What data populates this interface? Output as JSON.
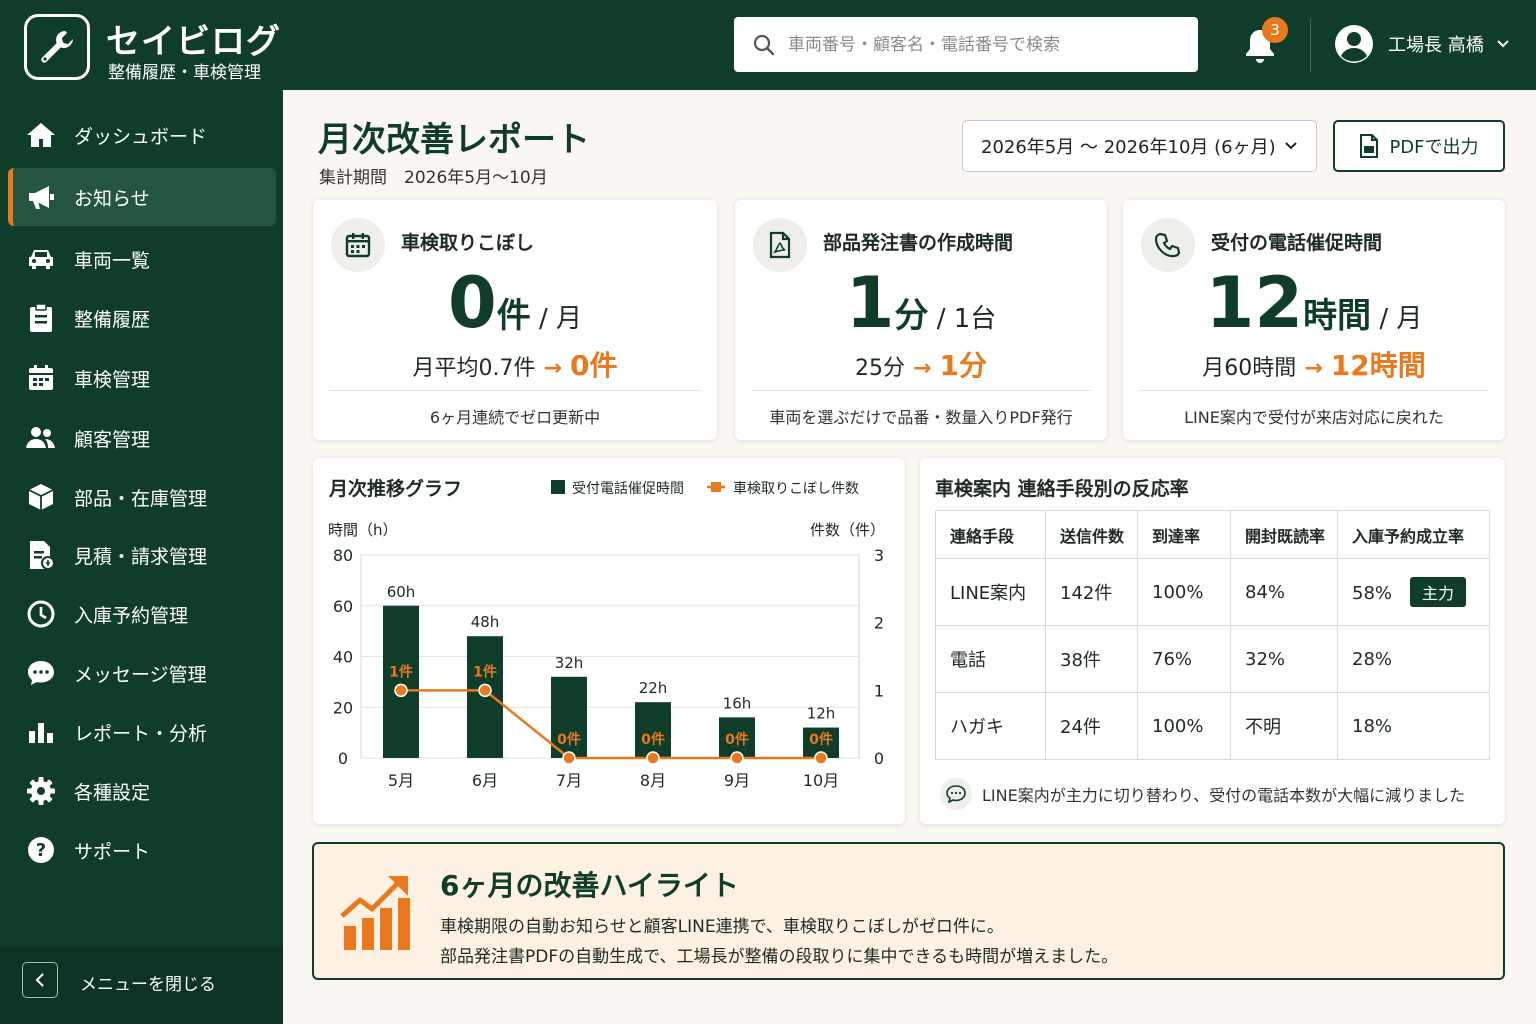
{
  "app": {
    "title": "セイビログ",
    "subtitle": "整備履歴・車検管理"
  },
  "search": {
    "placeholder": "車両番号・顧客名・電話番号で検索"
  },
  "notifications": {
    "count": "3"
  },
  "user": {
    "name": "工場長 高橋"
  },
  "sidebar": {
    "items": [
      {
        "label": "ダッシュボード",
        "icon": "home-icon"
      },
      {
        "label": "お知らせ",
        "icon": "megaphone-icon",
        "active": true
      },
      {
        "label": "車両一覧",
        "icon": "car-icon"
      },
      {
        "label": "整備履歴",
        "icon": "clipboard-icon"
      },
      {
        "label": "車検管理",
        "icon": "calendar-icon"
      },
      {
        "label": "顧客管理",
        "icon": "users-icon"
      },
      {
        "label": "部品・在庫管理",
        "icon": "box-icon"
      },
      {
        "label": "見積・請求管理",
        "icon": "invoice-icon"
      },
      {
        "label": "入庫予約管理",
        "icon": "clock-icon"
      },
      {
        "label": "メッセージ管理",
        "icon": "chat-icon"
      },
      {
        "label": "レポート・分析",
        "icon": "bar-chart-icon"
      },
      {
        "label": "各種設定",
        "icon": "gear-icon"
      },
      {
        "label": "サポート",
        "icon": "help-icon"
      }
    ],
    "close_label": "メニューを閉じる"
  },
  "header": {
    "title": "月次改善レポート",
    "period": "集計期間　2026年5月〜10月",
    "period_select": "2026年5月 〜 2026年10月 (6ヶ月)",
    "pdf_button": "PDFで出力"
  },
  "kpis": [
    {
      "title": "車検取りこぼし",
      "value": "0",
      "unit": "件",
      "per": " / 月",
      "before": "月平均0.7件",
      "after": "0件",
      "note": "6ヶ月連続でゼロ更新中",
      "icon": "calendar-icon"
    },
    {
      "title": "部品発注書の作成時間",
      "value": "1",
      "unit": "分",
      "per": " / 1台",
      "before": "25分",
      "after": "1分",
      "note": "車両を選ぶだけで品番・数量入りPDF発行",
      "icon": "pdf-file-icon"
    },
    {
      "title": "受付の電話催促時間",
      "value": "12",
      "unit": "時間",
      "per": " / 月",
      "before": "月60時間",
      "after": "12時間",
      "note": "LINE案内で受付が来店対応に戻れた",
      "icon": "phone-icon"
    }
  ],
  "monthly_chart": {
    "title": "月次推移グラフ",
    "legend_bar": "受付電話催促時間",
    "legend_line": "車検取りこぼし件数"
  },
  "chart_data": {
    "type": "bar",
    "categories": [
      "5月",
      "6月",
      "7月",
      "8月",
      "9月",
      "10月"
    ],
    "series": [
      {
        "name": "受付電話催促時間",
        "type": "bar",
        "axis": "left",
        "values": [
          60,
          48,
          32,
          22,
          16,
          12
        ],
        "labels": [
          "60h",
          "48h",
          "32h",
          "22h",
          "16h",
          "12h"
        ],
        "color": "#0f3d2a"
      },
      {
        "name": "車検取りこぼし件数",
        "type": "line",
        "axis": "right",
        "values": [
          1,
          1,
          0,
          0,
          0,
          0
        ],
        "labels": [
          "1件",
          "1件",
          "0件",
          "0件",
          "0件",
          "0件"
        ],
        "color": "#e8791f"
      }
    ],
    "ylabel_left": "時間（h）",
    "ylabel_right": "件数（件）",
    "ylim_left": [
      0,
      80
    ],
    "yticks_left": [
      "80",
      "60",
      "40",
      "20",
      "0"
    ],
    "ylim_right": [
      0,
      3
    ],
    "yticks_right": [
      "3",
      "2",
      "1",
      "0"
    ],
    "grid": true
  },
  "response_table": {
    "title": "車検案内 連絡手段別の反応率",
    "headers": [
      "連絡手段",
      "送信件数",
      "到達率",
      "開封既読率",
      "入庫予約成立率"
    ],
    "rows": [
      [
        "LINE案内",
        "142件",
        "100%",
        "84%",
        "58%"
      ],
      [
        "電話",
        "38件",
        "76%",
        "32%",
        "28%"
      ],
      [
        "ハガキ",
        "24件",
        "100%",
        "不明",
        "18%"
      ]
    ],
    "badge": "主力",
    "note": "LINE案内が主力に切り替わり、受付の電話本数が大幅に減りました"
  },
  "highlight": {
    "title": "6ヶ月の改善ハイライト",
    "line1": "車検期限の自動お知らせと顧客LINE連携で、車検取りこぼしがゼロ件に。",
    "line2": "部品発注書PDFの自動生成で、工場長が整備の段取りに集中できるも時間が増えました。"
  },
  "colors": {
    "brand": "#0f3d2a",
    "accent": "#e8791f",
    "highlight_bg": "#fdf1e2"
  }
}
